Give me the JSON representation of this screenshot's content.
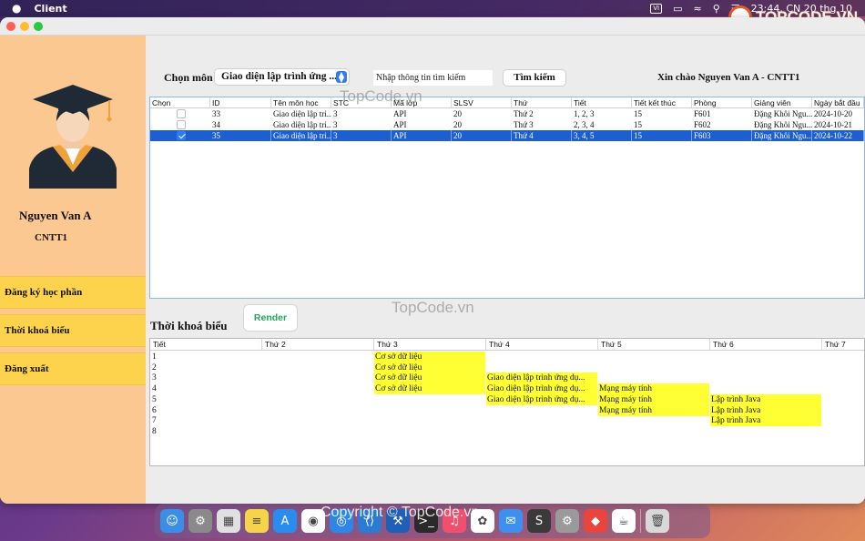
{
  "menubar": {
    "app_name": "Client",
    "clock": "23:44, CN 20 thg 10",
    "input_indicator": "VI"
  },
  "sidebar": {
    "user_name": "Nguyen Van A",
    "user_class": "CNTT1",
    "menu": [
      {
        "label": "Đăng ký học phần"
      },
      {
        "label": "Thời khoá biểu"
      },
      {
        "label": "Đăng xuất"
      }
    ]
  },
  "toolbar": {
    "subject_label": "Chọn môn",
    "subject_selected": "Giao diện lập trình ứng ...",
    "search_placeholder": "Nhập thông tin tìm kiếm",
    "search_button": "Tìm kiếm",
    "greeting": "Xin chào Nguyen Van A - CNTT1"
  },
  "course_table": {
    "columns": [
      "Chọn",
      "ID",
      "Tên môn học",
      "STC",
      "Mã lớp",
      "SLSV",
      "Thứ",
      "Tiết",
      "Tiết kết thúc",
      "Phòng",
      "Giảng viên",
      "Ngày bắt đầu"
    ],
    "rows": [
      {
        "checked": false,
        "selected": false,
        "id": "33",
        "ten_mon": "Giao diện lập tri...",
        "stc": "3",
        "ma_lop": "API",
        "slsv": "20",
        "thu": "Thứ 2",
        "tiet": "1, 2, 3",
        "tiet_ket_thuc": "15",
        "phong": "F601",
        "giang_vien": "Đặng Khôi Ngu...",
        "ngay_bat_dau": "2024-10-20"
      },
      {
        "checked": false,
        "selected": false,
        "id": "34",
        "ten_mon": "Giao diện lập tri...",
        "stc": "3",
        "ma_lop": "API",
        "slsv": "20",
        "thu": "Thứ 3",
        "tiet": "2, 3, 4",
        "tiet_ket_thuc": "15",
        "phong": "F602",
        "giang_vien": "Đặng Khôi Ngu...",
        "ngay_bat_dau": "2024-10-21"
      },
      {
        "checked": true,
        "selected": true,
        "id": "35",
        "ten_mon": "Giao diện lập tri...",
        "stc": "3",
        "ma_lop": "API",
        "slsv": "20",
        "thu": "Thứ 4",
        "tiet": "3, 4, 5",
        "tiet_ket_thuc": "15",
        "phong": "F603",
        "giang_vien": "Đặng Khôi Ngu...",
        "ngay_bat_dau": "2024-10-22"
      }
    ]
  },
  "schedule": {
    "title": "Thời khoá biểu",
    "render_button": "Render",
    "columns": [
      "Tiết",
      "Thứ 2",
      "Thứ 3",
      "Thứ 4",
      "Thứ 5",
      "Thứ 6",
      "Thứ 7"
    ],
    "rows": [
      {
        "tiet": "1",
        "cells": [
          "",
          "Cơ sở dữ liệu",
          "",
          "",
          "",
          ""
        ]
      },
      {
        "tiet": "2",
        "cells": [
          "",
          "Cơ sở dữ liệu",
          "",
          "",
          "",
          ""
        ]
      },
      {
        "tiet": "3",
        "cells": [
          "",
          "Cơ sở dữ liệu",
          "Giao diện lập trình ứng dụ...",
          "",
          "",
          ""
        ]
      },
      {
        "tiet": "4",
        "cells": [
          "",
          "Cơ sở dữ liệu",
          "Giao diện lập trình ứng dụ...",
          "Mạng máy tính",
          "",
          ""
        ]
      },
      {
        "tiet": "5",
        "cells": [
          "",
          "",
          "Giao diện lập trình ứng dụ...",
          "Mạng máy tính",
          "Lập trình Java",
          ""
        ]
      },
      {
        "tiet": "6",
        "cells": [
          "",
          "",
          "",
          "Mạng máy tính",
          "Lập trình Java",
          ""
        ]
      },
      {
        "tiet": "7",
        "cells": [
          "",
          "",
          "",
          "",
          "Lập trình Java",
          ""
        ]
      },
      {
        "tiet": "8",
        "cells": [
          "",
          "",
          "",
          "",
          "",
          ""
        ]
      }
    ],
    "filled_color": "#ffff33"
  },
  "watermarks": {
    "text1": "TopCode.vn",
    "text2": "TopCode.vn",
    "text3": "Copyright © TopCode.vn",
    "logo": "TOPCODE.VN"
  },
  "dock": {
    "icons": [
      "finder-icon",
      "system-settings-icon",
      "launchpad-icon",
      "notes-icon",
      "app-store-icon",
      "chrome-icon",
      "safari-icon",
      "vscode-icon",
      "xcode-icon",
      "terminal-icon",
      "music-icon",
      "photos-icon",
      "mail-icon",
      "sublime-icon",
      "preferences-icon",
      "anydesk-icon",
      "java-icon",
      "trash-icon"
    ],
    "badge_count": "1"
  },
  "colors": {
    "sidebar_bg": "#fcc892",
    "menu_button_bg": "#fdd24c",
    "selection_blue": "#1d5fd0",
    "render_text_green": "#23a85a"
  }
}
